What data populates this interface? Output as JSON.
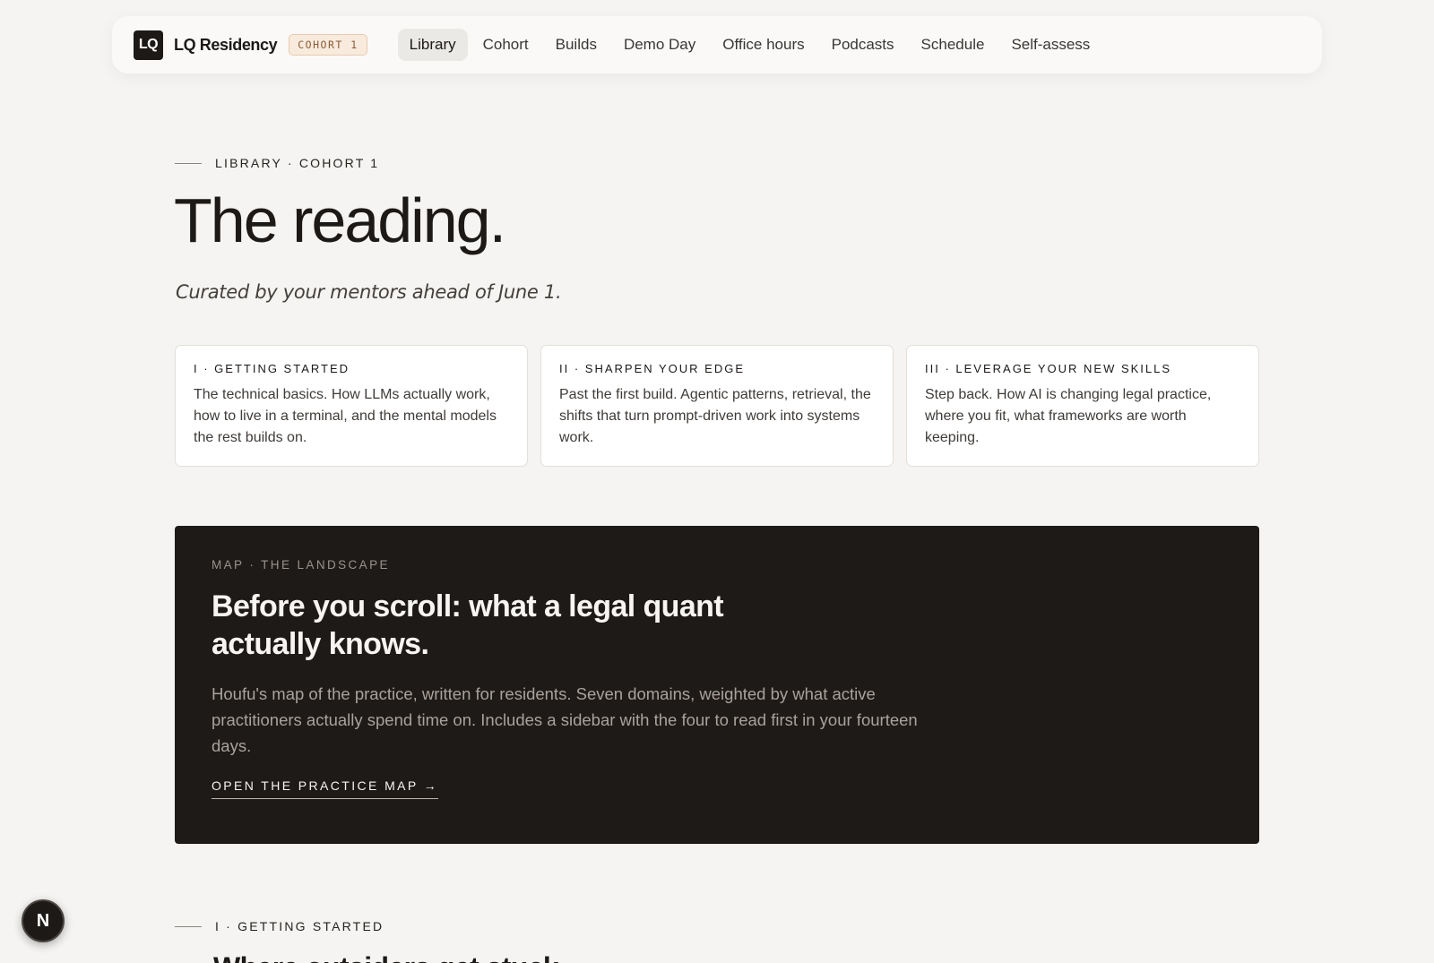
{
  "nav": {
    "logo_text": "LQ",
    "brand": "LQ Residency",
    "cohort_badge": "COHORT 1",
    "links": [
      {
        "label": "Library",
        "active": true
      },
      {
        "label": "Cohort"
      },
      {
        "label": "Builds"
      },
      {
        "label": "Demo Day"
      },
      {
        "label": "Office hours"
      },
      {
        "label": "Podcasts"
      },
      {
        "label": "Schedule"
      },
      {
        "label": "Self-assess"
      }
    ]
  },
  "hero": {
    "eyebrow": "LIBRARY · COHORT 1",
    "title": "The reading.",
    "subtitle": "Curated by your mentors ahead of June 1."
  },
  "sections": [
    {
      "title": "I · GETTING STARTED",
      "description": "The technical basics. How LLMs actually work, how to live in a terminal, and the mental models the rest builds on."
    },
    {
      "title": "II · SHARPEN YOUR EDGE",
      "description": "Past the first build. Agentic patterns, retrieval, the shifts that turn prompt-driven work into systems work."
    },
    {
      "title": "III · LEVERAGE YOUR NEW SKILLS",
      "description": "Step back. How AI is changing legal practice, where you fit, what frameworks are worth keeping."
    }
  ],
  "map": {
    "eyebrow": "MAP · THE LANDSCAPE",
    "title": "Before you scroll: what a legal quant actually knows.",
    "description": "Houfu's map of the practice, written for residents. Seven domains, weighted by what active practitioners actually spend time on. Includes a sidebar with the four to read first in your fourteen days.",
    "link_label": "OPEN THE PRACTICE MAP →"
  },
  "lower": {
    "eyebrow": "I · GETTING STARTED",
    "heading": "Where outsiders get stuck"
  },
  "fab": {
    "label": "N"
  },
  "colors": {
    "background": "#f5f4f2",
    "dark_panel": "#1e1a18",
    "badge_bg": "#f8ebdd",
    "badge_text": "#8f5a34"
  }
}
